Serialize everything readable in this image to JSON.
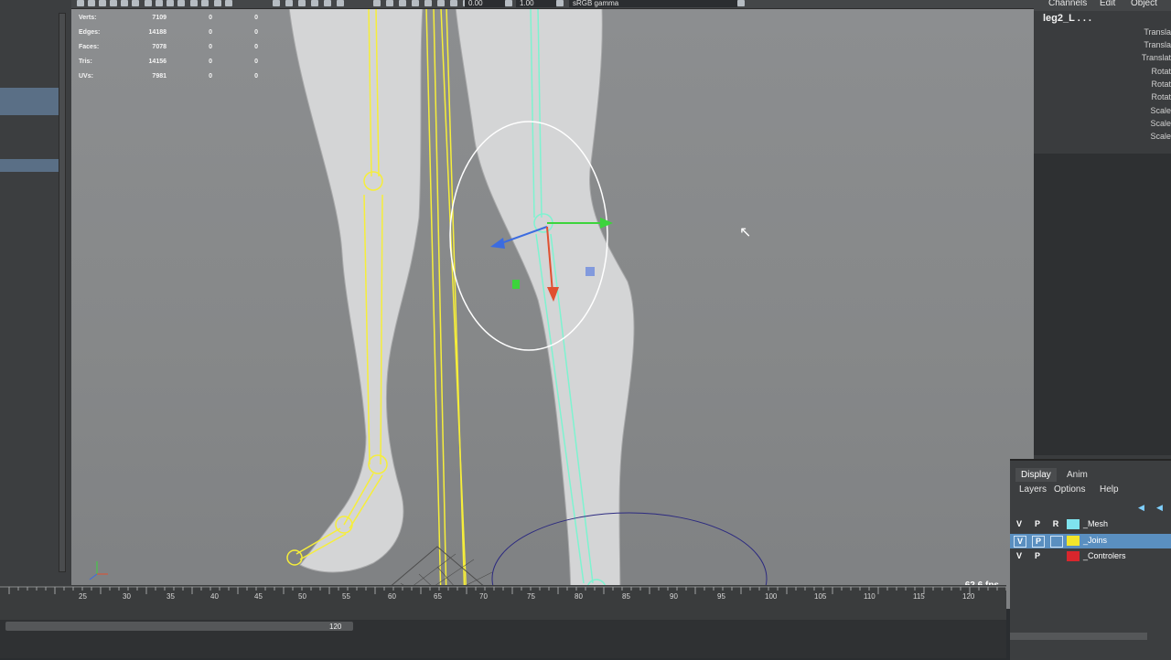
{
  "toolbar": {
    "field_a": "0.00",
    "field_b": "1.00",
    "colorspace": "sRGB gamma"
  },
  "hud": {
    "rows": [
      {
        "label": "Verts:",
        "value": "7109",
        "sel": "0",
        "comp": "0"
      },
      {
        "label": "Edges:",
        "value": "14188",
        "sel": "0",
        "comp": "0"
      },
      {
        "label": "Faces:",
        "value": "7078",
        "sel": "0",
        "comp": "0"
      },
      {
        "label": "Tris:",
        "value": "14156",
        "sel": "0",
        "comp": "0"
      },
      {
        "label": "UVs:",
        "value": "7981",
        "sel": "0",
        "comp": "0"
      }
    ]
  },
  "viewport": {
    "camera": "persp",
    "fps": "62.6 fps"
  },
  "channel_box": {
    "menu": [
      "Channels",
      "Edit",
      "Object"
    ],
    "node_name": "leg2_L . . .",
    "attributes": [
      "Transla",
      "Transla",
      "Translat",
      "Rotat",
      "Rotat",
      "Rotat",
      "Scale",
      "Scale",
      "Scale"
    ]
  },
  "layer_editor": {
    "tabs": [
      "Display",
      "Anim"
    ],
    "menu": [
      "Layers",
      "Options",
      "Help"
    ],
    "layers": [
      {
        "v": "V",
        "p": "P",
        "r": "R",
        "name": "_Mesh",
        "color": "#7fe3ee",
        "selected": false
      },
      {
        "v": "V",
        "p": "P",
        "r": "",
        "name": "_Joins",
        "color": "#f2e52a",
        "selected": true
      },
      {
        "v": "V",
        "p": "P",
        "r": "",
        "name": "_Controlers",
        "color": "#d8262d",
        "selected": false
      }
    ]
  },
  "timeline": {
    "ticks": [
      "25",
      "30",
      "35",
      "40",
      "45",
      "50",
      "55",
      "60",
      "65",
      "70",
      "75",
      "80",
      "85",
      "90",
      "95",
      "100",
      "105",
      "110",
      "115",
      "120"
    ],
    "range_end": "120"
  },
  "colors": {
    "joint": "#f6ee3a",
    "selected_joint": "#7ef3d0",
    "viewport_bg": "#878889"
  }
}
